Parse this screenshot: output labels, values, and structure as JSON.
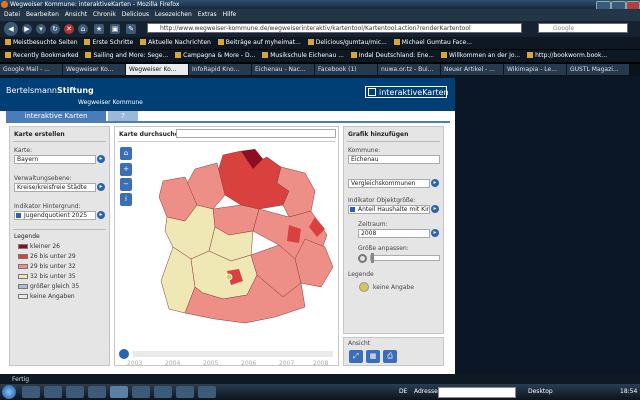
{
  "window": {
    "title": "Wegweiser Kommune: interaktiveKarten - Mozilla Firefox"
  },
  "menu": [
    "Datei",
    "Bearbeiten",
    "Ansicht",
    "Chronik",
    "Delicious",
    "Lesezeichen",
    "Extras",
    "Hilfe"
  ],
  "nav": {
    "url": "http://www.wegweiser-kommune.de/wegweiserinteraktiv/kartentool/Kartentool.action?renderKartentool",
    "search_placeholder": "Google"
  },
  "bookmarks1": [
    "Meistbesuchte Seiten",
    "Erste Schritte",
    "Aktuelle Nachrichten",
    "Beiträge auf myheimat...",
    "Delicious/gumtau/mic...",
    "Michael Gumtau Face..."
  ],
  "bookmarks2": [
    "Recently Bookmarked",
    "Sailing and More: Sege...",
    "Campagna & More - D...",
    "Musikschule Eichenau ...",
    "Indal Deutschland: Ene...",
    "Willkommen an der Jo...",
    "http://bookworm.book..."
  ],
  "tabs": [
    "Google Mail - ...",
    "Wegweiser Ko...",
    "Wegweiser Ko...",
    "InfoRapid Kno...",
    "Eichenau - Nac...",
    "Facebook (1)",
    "nuwa.or.tz - Bui...",
    "Neuer Artikel - ...",
    "Wikimapia - Le...",
    "GUSTL Magazi..."
  ],
  "site": {
    "brand_light": "Bertelsmann",
    "brand_bold": "Stiftung",
    "subtitle": "Wegweiser Kommune",
    "product": "interaktiveKarten",
    "tab_main": "interaktive Karten",
    "tab_help": "?"
  },
  "left": {
    "title": "Karte erstellen",
    "karte_label": "Karte:",
    "karte_value": "Bayern",
    "verwaltung_label": "Verwaltungsebene:",
    "verwaltung_value": "Kreise/kreisfreie Städte",
    "indikator_label": "Indikator Hintergrund:",
    "indikator_value": "Jugendquotient 2025",
    "legende_title": "Legende",
    "legend": [
      {
        "label": "kleiner 26",
        "color": "#8b0f1f"
      },
      {
        "label": "26 bis unter 29",
        "color": "#d9413f"
      },
      {
        "label": "29 bis unter 32",
        "color": "#ee8f87"
      },
      {
        "label": "32 bis unter 35",
        "color": "#efe8b5"
      },
      {
        "label": "größer gleich 35",
        "color": "#a7bfd9"
      },
      {
        "label": "keine Angaben",
        "color": "#e8e8e8"
      }
    ]
  },
  "center": {
    "title": "Karte durchsuchen",
    "search_value": "",
    "timeline": [
      "2003",
      "2004",
      "2005",
      "2006",
      "2007",
      "2008"
    ]
  },
  "right": {
    "title": "Grafik hinzufügen",
    "kommune_label": "Kommune:",
    "kommune_value": "Eichenau",
    "vergleich": "Vergleichskommunen",
    "obj_label": "Indikator Objektgröße:",
    "obj_value": "Anteil Haushalte mit Kin...",
    "zeitraum_label": "Zeitraum:",
    "zeitraum_value": "2008",
    "groesse_label": "Größe anpassen:",
    "legende_title": "Legende",
    "legende_item": "keine Angabe",
    "ansicht_title": "Ansicht"
  },
  "status": {
    "text": "Fertig"
  },
  "taskbar": {
    "adresse": "Adresse",
    "desktop": "Desktop",
    "de": "DE",
    "clock": "18:54"
  },
  "colors": {
    "brand": "#003e76",
    "accent": "#4a7cb8"
  }
}
